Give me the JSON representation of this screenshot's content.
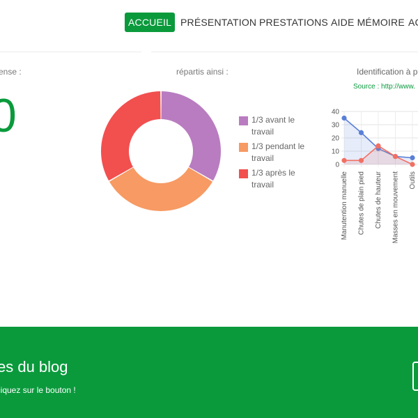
{
  "nav": {
    "items": [
      {
        "label": "ACCUEIL",
        "active": true
      },
      {
        "label": "PRÉSENTATION",
        "active": false
      },
      {
        "label": "PRESTATIONS",
        "active": false
      },
      {
        "label": "AIDE MÉMOIRE",
        "active": false
      },
      {
        "label": "AC",
        "active": false
      }
    ]
  },
  "stats": {
    "left_label": "ense :",
    "big_value": "0",
    "middle_label": "répartis ainsi :",
    "right_title": "Identification à p",
    "right_source": "Source : http://www."
  },
  "colors": {
    "accent": "#0a9a3c",
    "purple": "#b97cc0",
    "orange": "#f79a63",
    "red": "#f24f4f",
    "blue": "#5a7fd6",
    "salmon": "#f26f63"
  },
  "chart_data": [
    {
      "type": "pie",
      "donut": true,
      "categories": [
        "1/3 avant le travail",
        "1/3 pendant le travail",
        "1/3 après le travail"
      ],
      "values": [
        33.3,
        33.3,
        33.3
      ],
      "colors": [
        "#b97cc0",
        "#f79a63",
        "#f24f4f"
      ],
      "legend": "right"
    },
    {
      "type": "line",
      "title": "Identification à p",
      "categories": [
        "Manutention manuelle",
        "Chutes de plain pied",
        "Chutes de hauteur",
        "Masses en mouvement",
        "Outils"
      ],
      "series": [
        {
          "values": [
            35,
            24,
            12,
            6,
            5
          ],
          "color": "#5a7fd6",
          "fill": "rgba(90,127,214,0.15)"
        },
        {
          "values": [
            3,
            3,
            14,
            6,
            0
          ],
          "color": "#f26f63",
          "fill": "rgba(242,111,99,0.15)"
        }
      ],
      "yticks": [
        0,
        10,
        20,
        30,
        40
      ],
      "ylim": [
        0,
        40
      ]
    }
  ],
  "band": {
    "title": "es du blog",
    "subtitle": "liquez sur le bouton !"
  }
}
